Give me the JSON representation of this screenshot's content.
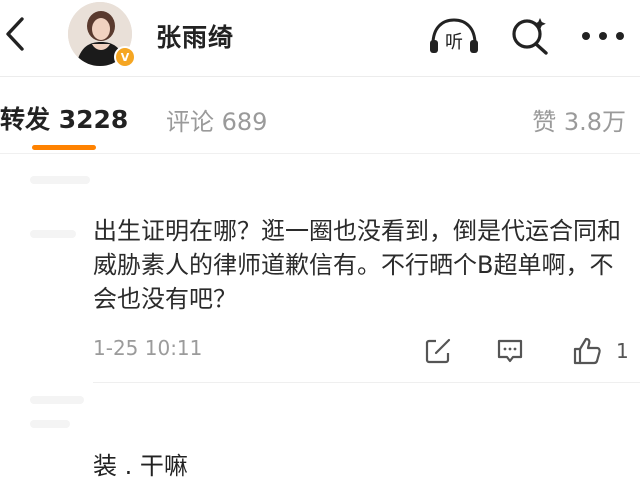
{
  "header": {
    "username": "张雨绮",
    "verified_badge": "V",
    "icons": [
      "back-icon",
      "listen-icon",
      "search-icon",
      "more-icon"
    ],
    "listen_label": "听"
  },
  "tabs": {
    "repost": "转发 3228",
    "comment": "评论 689",
    "like": "赞 3.8万",
    "accent": "#ff8200"
  },
  "comment": {
    "text": "出生证明在哪？逛一圈也没看到，倒是代运合同和威胁素人的律师道歉信有。不行晒个B超单啊，不会也没有吧？",
    "time": "1-25 10:11",
    "like_count": "1"
  },
  "next_item": {
    "text": "装 . 干嘛"
  }
}
